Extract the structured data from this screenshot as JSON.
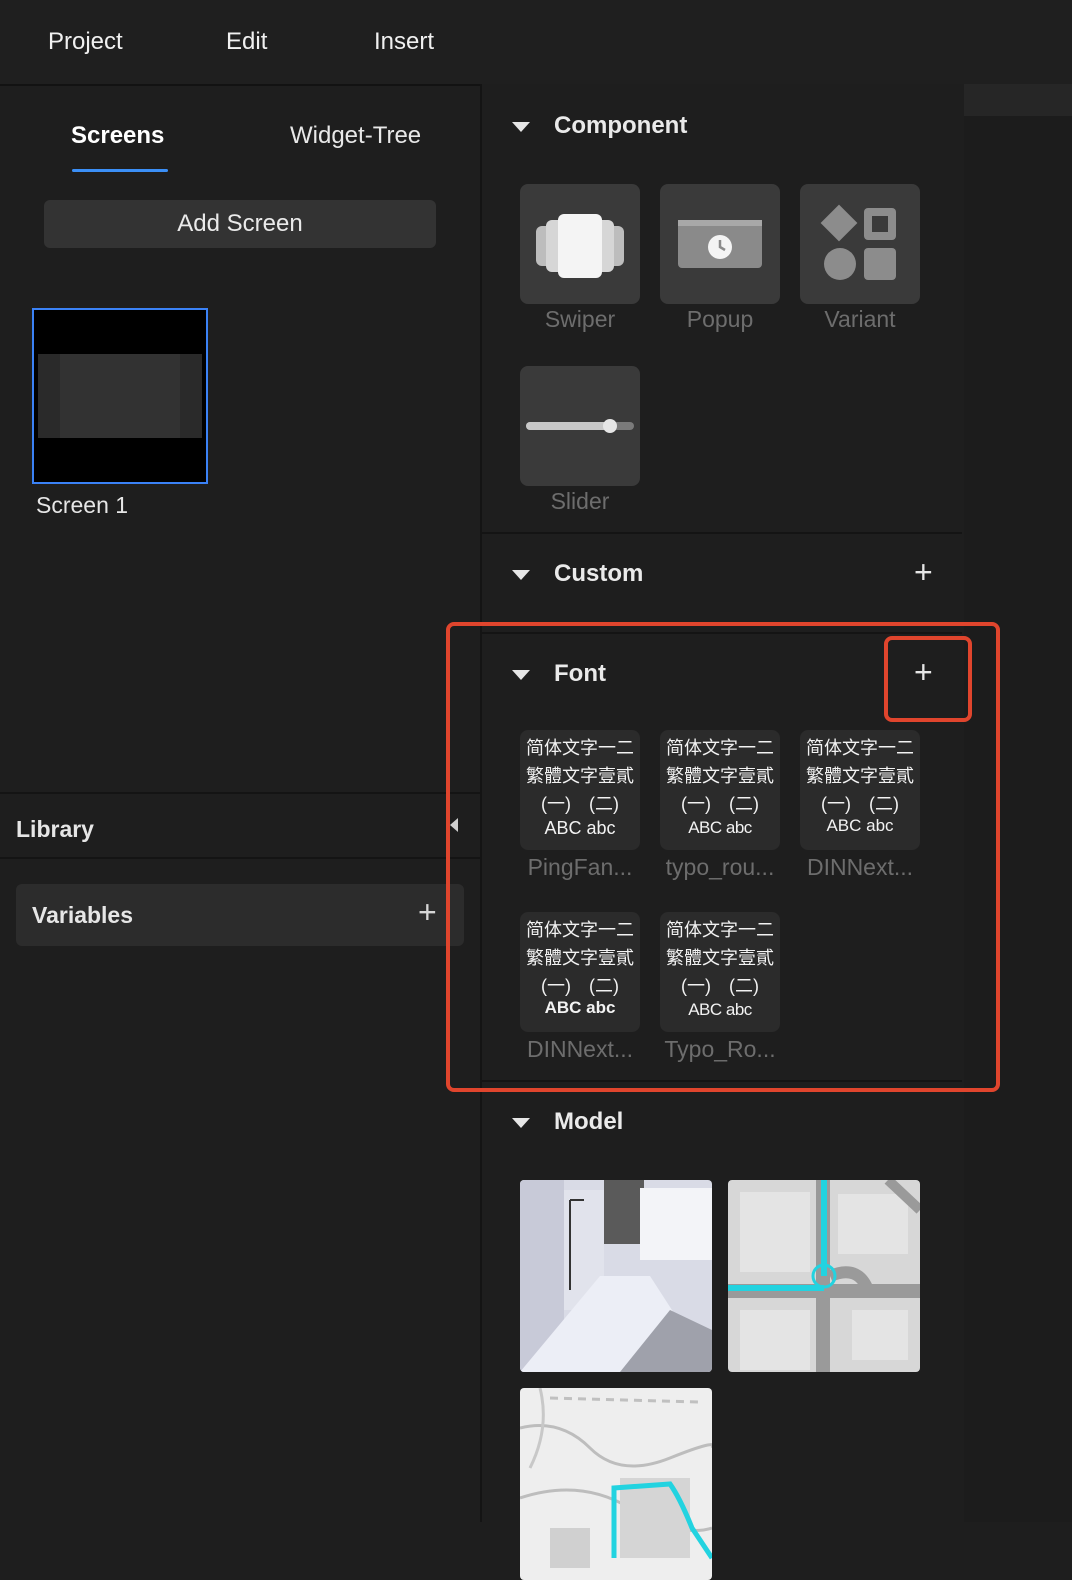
{
  "menu": {
    "project": "Project",
    "edit": "Edit",
    "insert": "Insert"
  },
  "left": {
    "tabs": {
      "screens": "Screens",
      "widget_tree": "Widget-Tree"
    },
    "add_screen": "Add Screen",
    "screens": [
      {
        "label": "Screen 1"
      }
    ],
    "library": "Library",
    "variables": "Variables",
    "plus": "+"
  },
  "component": {
    "title": "Component",
    "items": [
      {
        "label": "Swiper",
        "icon": "swiper-icon"
      },
      {
        "label": "Popup",
        "icon": "popup-icon"
      },
      {
        "label": "Variant",
        "icon": "variant-icon"
      },
      {
        "label": "Slider",
        "icon": "slider-icon"
      }
    ]
  },
  "custom": {
    "title": "Custom",
    "plus": "+"
  },
  "font": {
    "title": "Font",
    "plus": "+",
    "sample": {
      "line1": "简体文字一二",
      "line2": "繁體文字壹貳",
      "line3": "(一)　(二)",
      "line4": "ABC abc"
    },
    "items": [
      {
        "label": "PingFan..."
      },
      {
        "label": "typo_rou..."
      },
      {
        "label": "DINNext..."
      },
      {
        "label": "DINNext..."
      },
      {
        "label": "Typo_Ro..."
      }
    ]
  },
  "model": {
    "title": "Model"
  },
  "colors": {
    "accent": "#3b82f6",
    "highlight": "#e0452d",
    "teal": "#22d3e0"
  }
}
